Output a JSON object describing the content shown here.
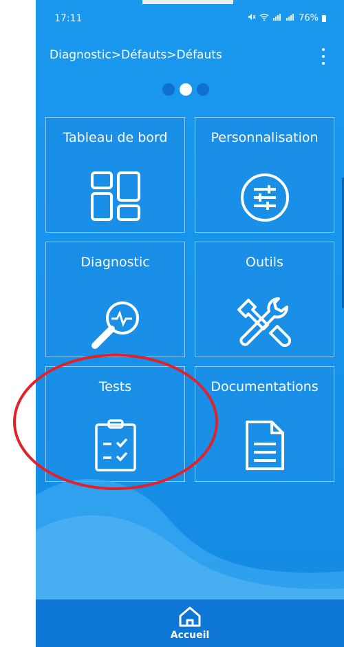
{
  "status": {
    "time": "17:11",
    "battery": "76%"
  },
  "header": {
    "breadcrumb": "Diagnostic>Défauts>Défauts"
  },
  "tiles": [
    {
      "label": "Tableau de bord"
    },
    {
      "label": "Personnalisation"
    },
    {
      "label": "Diagnostic"
    },
    {
      "label": "Outils"
    },
    {
      "label": "Tests"
    },
    {
      "label": "Documentations"
    }
  ],
  "bottom_nav": {
    "home_label": "Accueil"
  },
  "colors": {
    "background": "#1692ea",
    "tile": "#198fe8",
    "bottom_bar": "#0d76d6",
    "annotation": "#e0222b"
  }
}
